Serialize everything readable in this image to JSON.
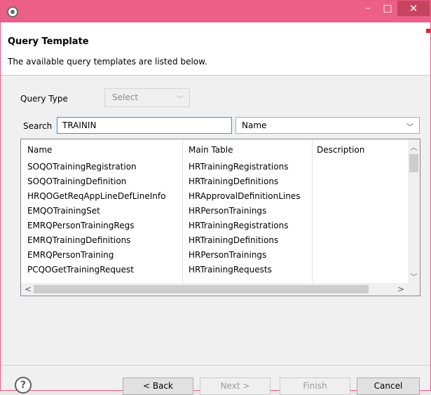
{
  "window": {
    "icon": "eclipse-gear-icon",
    "controls": {
      "minimize": "–",
      "maximize": "□",
      "close": "✕"
    },
    "accent_color": "#ec5f88"
  },
  "header": {
    "title": "Query Template",
    "description": "The available query templates are listed below."
  },
  "query_type": {
    "label": "Query Type",
    "value": "Select"
  },
  "search": {
    "label": "Search",
    "value": "TRAININ",
    "field": "Name"
  },
  "table": {
    "columns": [
      "Name",
      "Main Table",
      "Description"
    ],
    "rows": [
      {
        "name": "SOQOTrainingRegistration",
        "main_table": "HRTrainingRegistrations",
        "description": ""
      },
      {
        "name": "SOQOTrainingDefinition",
        "main_table": "HRTrainingDefinitions",
        "description": ""
      },
      {
        "name": "HRQOGetReqAppLineDefLineInfo",
        "main_table": "HRApprovalDefinitionLines",
        "description": ""
      },
      {
        "name": "EMQOTrainingSet",
        "main_table": "HRPersonTrainings",
        "description": ""
      },
      {
        "name": "EMRQPersonTrainingRegs",
        "main_table": "HRTrainingRegistrations",
        "description": ""
      },
      {
        "name": "EMRQTrainingDefinitions",
        "main_table": "HRTrainingDefinitions",
        "description": ""
      },
      {
        "name": "EMRQPersonTraining",
        "main_table": "HRPersonTrainings",
        "description": ""
      },
      {
        "name": "PCQOGetTrainingRequest",
        "main_table": "HRTrainingRequests",
        "description": ""
      }
    ]
  },
  "buttons": {
    "help": "?",
    "back": "< Back",
    "next": "Next >",
    "finish": "Finish",
    "cancel": "Cancel"
  }
}
